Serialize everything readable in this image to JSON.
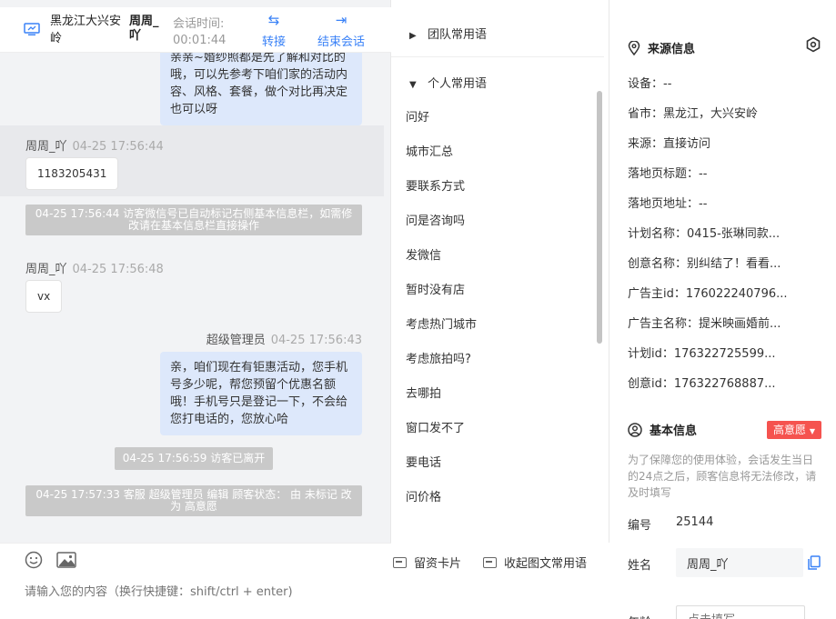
{
  "header": {
    "location": "黑龙江大兴安岭",
    "visitor_name": "周周_吖",
    "session_time_label": "会话时间:",
    "session_time": "00:01:44",
    "transfer_label": "转接",
    "end_label": "结束会话"
  },
  "messages": {
    "agent_msg_1": "亲亲~婚纱照都是先了解和对比的哦，可以先参考下咱们家的活动内容、风格、套餐，做个对比再决定也可以呀",
    "visitor_1": {
      "name": "周周_吖",
      "time": "04-25 17:56:44",
      "text": "1183205431"
    },
    "system_1": "04-25 17:56:44 访客微信号已自动标记右侧基本信息栏，如需修改请在基本信息栏直接操作",
    "visitor_2": {
      "name": "周周_吖",
      "time": "04-25 17:56:48",
      "text": "vx"
    },
    "agent_2": {
      "name": "超级管理员",
      "time": "04-25 17:56:43",
      "text": "亲，咱们现在有钜惠活动，您手机号多少呢，帮您预留个优惠名额哦！手机号只是登记一下，不会给您打电话的，您放心哈"
    },
    "system_2": "04-25 17:56:59 访客已离开",
    "system_3": "04-25 17:57:33 客服 超级管理员 编辑 顾客状态： 由 未标记 改为 高意愿"
  },
  "composer": {
    "card_label": "留资卡片",
    "collapse_label": "收起图文常用语",
    "placeholder": "请输入您的内容（换行快捷键：shift/ctrl + enter)"
  },
  "phrases": {
    "team_group": "团队常用语",
    "personal_group": "个人常用语",
    "items": [
      "问好",
      "城市汇总",
      "要联系方式",
      "问是咨询吗",
      "发微信",
      "暂时没有店",
      "考虑热门城市",
      "考虑旅拍吗?",
      "去哪拍",
      "窗口发不了",
      "要电话",
      "问价格"
    ]
  },
  "source_info": {
    "title": "来源信息",
    "rows": [
      "设备：--",
      "省市：黑龙江，大兴安岭",
      "来源：直接访问",
      "落地页标题：--",
      "落地页地址：--",
      "计划名称：0415-张琳同款...",
      "创意名称：别纠结了！看看...",
      "广告主id：176022240796...",
      "广告主名称：提米映画婚前...",
      "计划id：176322725599...",
      "创意id：176322768887..."
    ]
  },
  "basic_info": {
    "title": "基本信息",
    "intent_badge": "高意愿",
    "notice": "为了保障您的使用体验，会话发生当日的24点之后，顾客信息将无法修改，请及时填写",
    "id_label": "编号",
    "id_value": "25144",
    "name_label": "姓名",
    "name_value": "周周_吖",
    "age_label": "年龄",
    "age_placeholder": "点击填写"
  },
  "colors": {
    "accent": "#3a82f7",
    "badge": "#f5534f",
    "bubble": "#dde8fb",
    "system": "#c9c9c9"
  }
}
